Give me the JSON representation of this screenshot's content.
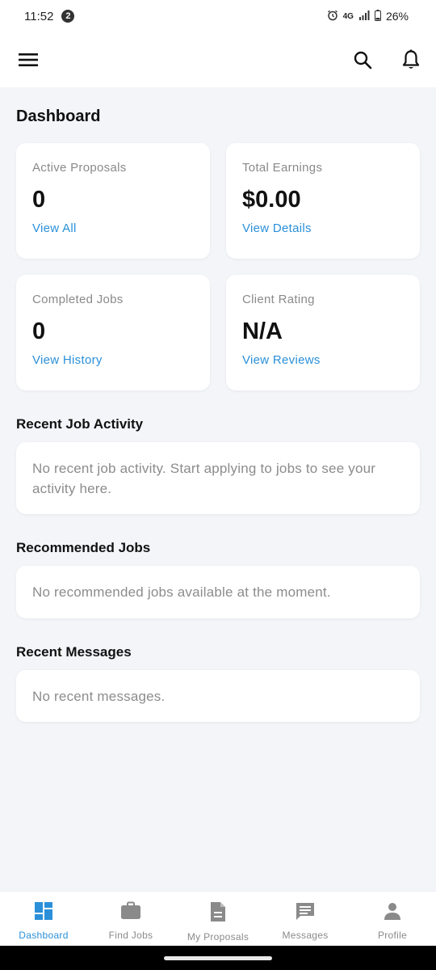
{
  "status_bar": {
    "time": "11:52",
    "notification_count": "2",
    "network": "4G",
    "battery": "26%",
    "icons": [
      "alarm-icon",
      "signal-icon",
      "battery-icon"
    ]
  },
  "app_bar": {
    "icons": [
      "menu-icon",
      "search-icon",
      "bell-icon"
    ]
  },
  "page": {
    "title": "Dashboard"
  },
  "stats": [
    {
      "label": "Active Proposals",
      "value": "0",
      "link": "View All"
    },
    {
      "label": "Total Earnings",
      "value": "$0.00",
      "link": "View Details"
    },
    {
      "label": "Completed Jobs",
      "value": "0",
      "link": "View History"
    },
    {
      "label": "Client Rating",
      "value": "N/A",
      "link": "View Reviews"
    }
  ],
  "sections": {
    "recent_activity": {
      "title": "Recent Job Activity",
      "empty_text": "No recent job activity. Start applying to jobs to see your activity here."
    },
    "recommended": {
      "title": "Recommended Jobs",
      "empty_text": "No recommended jobs available at the moment."
    },
    "messages": {
      "title": "Recent Messages",
      "empty_text": "No recent messages."
    }
  },
  "bottom_nav": [
    {
      "label": "Dashboard",
      "icon": "dashboard-icon",
      "active": true
    },
    {
      "label": "Find Jobs",
      "icon": "briefcase-icon",
      "active": false
    },
    {
      "label": "My Proposals",
      "icon": "document-icon",
      "active": false
    },
    {
      "label": "Messages",
      "icon": "message-icon",
      "active": false
    },
    {
      "label": "Profile",
      "icon": "person-icon",
      "active": false
    }
  ],
  "colors": {
    "accent": "#2b90d9",
    "background": "#f3f5f9",
    "card": "#ffffff",
    "muted_text": "#8a8a8a"
  }
}
